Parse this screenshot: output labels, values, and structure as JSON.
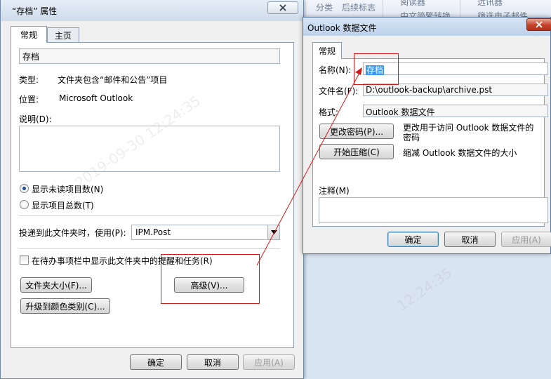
{
  "background": {
    "ribbon_items": [
      "分类",
      "后续标志",
      "阅读器",
      "中文简繁转换",
      "远讯器",
      "筛选电子邮件"
    ]
  },
  "props_dialog": {
    "title": "“存档” 属性",
    "tabs": [
      "常规",
      "主页"
    ],
    "folder_name": "存档",
    "type_label": "类型:",
    "type_value": "文件夹包含“邮件和公告”项目",
    "location_label": "位置:",
    "location_value": "Microsoft Outlook",
    "description_label": "说明(D):",
    "radio_unread": "显示未读项目数(N)",
    "radio_total": "显示项目总数(T)",
    "post_label": "投递到此文件夹时，使用(P):",
    "post_value": "IPM.Post",
    "todo_checkbox": "在待办事项栏中显示此文件夹中的提醒和任务(R)",
    "folder_size_button": "文件夹大小(F)...",
    "advanced_button": "高级(V)...",
    "upgrade_button": "升级到颜色类别(C)...",
    "ok_button": "确定",
    "cancel_button": "取消",
    "apply_button": "应用(A)"
  },
  "ost_dialog": {
    "title": "Outlook 数据文件",
    "tab": "常规",
    "name_label": "名称(N):",
    "name_value": "存档",
    "filename_label": "文件名(F):",
    "filename_value": "D:\\outlook-backup\\archive.pst",
    "format_label": "格式:",
    "format_value": "Outlook 数据文件",
    "change_password_button": "更改密码(P)...",
    "change_password_desc": "更改用于访问 Outlook 数据文件的密码",
    "compact_button": "开始压缩(C)",
    "compact_desc": "缩减 Outlook 数据文件的大小",
    "comment_label": "注释(M)",
    "ok_button": "确定",
    "cancel_button": "取消",
    "apply_button": "应用(A)"
  },
  "colors": {
    "annotation": "#d11a1a",
    "accent": "#3c7fb1"
  }
}
